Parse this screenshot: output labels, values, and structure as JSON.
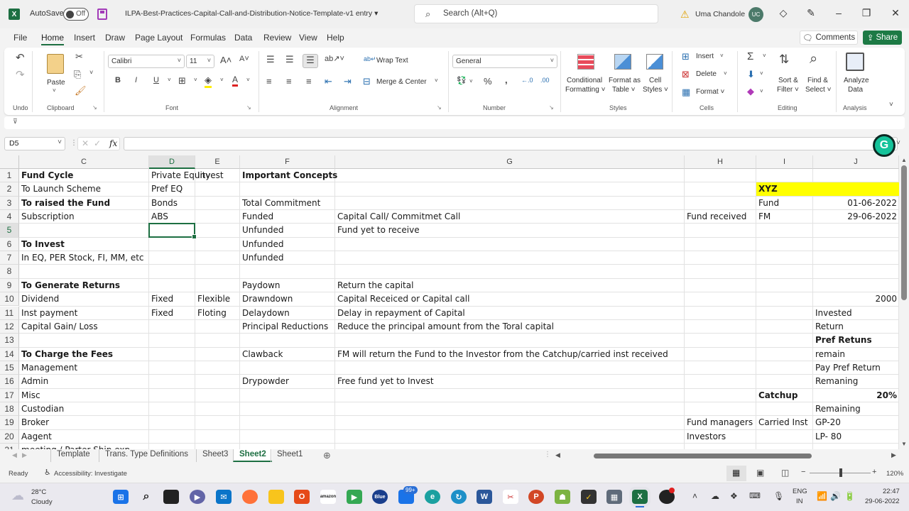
{
  "window": {
    "app_logo": "X",
    "autosave_label": "AutoSave",
    "autosave_state": "Off",
    "document_title": "ILPA-Best-Practices-Capital-Call-and-Distribution-Notice-Template-v1 entry",
    "title_dropdown": "▾",
    "search_placeholder": "Search (Alt+Q)",
    "user_name": "Uma Chandole",
    "user_initials": "UC"
  },
  "menu": {
    "tabs": [
      "File",
      "Home",
      "Insert",
      "Draw",
      "Page Layout",
      "Formulas",
      "Data",
      "Review",
      "View",
      "Help"
    ],
    "active_tab": "Home",
    "comments_label": "Comments",
    "share_label": "Share"
  },
  "ribbon": {
    "groups": {
      "undo": "Undo",
      "clipboard": "Clipboard",
      "font": "Font",
      "alignment": "Alignment",
      "number": "Number",
      "styles": "Styles",
      "cells": "Cells",
      "editing": "Editing",
      "analysis": "Analysis"
    },
    "paste_label": "Paste",
    "font_name": "Calibri",
    "font_size": "11",
    "wrap_text": "Wrap Text",
    "merge_center": "Merge & Center",
    "number_format": "General",
    "conditional_formatting": [
      "Conditional",
      "Formatting ˅"
    ],
    "format_as_table": [
      "Format as",
      "Table ˅"
    ],
    "cell_styles": [
      "Cell",
      "Styles ˅"
    ],
    "insert": "Insert",
    "delete": "Delete",
    "format": "Format",
    "sort_filter": [
      "Sort &",
      "Filter ˅"
    ],
    "find_select": [
      "Find &",
      "Select ˅"
    ],
    "analyze_data": [
      "Analyze",
      "Data"
    ]
  },
  "formula_bar": {
    "name_box": "D5",
    "formula": ""
  },
  "sheet": {
    "columns": [
      "C",
      "D",
      "E",
      "F",
      "G",
      "H",
      "I",
      "J"
    ],
    "selected_column": "D",
    "rows": [
      "1",
      "2",
      "3",
      "4",
      "5",
      "6",
      "7",
      "8",
      "9",
      "10",
      "11",
      "12",
      "13",
      "14",
      "15",
      "16",
      "17",
      "18",
      "19",
      "20",
      "21"
    ],
    "selected_row": "5",
    "selected_cell": "D5",
    "cells": {
      "C1": "Fund Cycle",
      "D1": "Private Equity",
      "E1": "Invest",
      "F1": "Important Concepts",
      "C2": "To Launch Scheme",
      "D2": "Pref EQ",
      "I2": "XYZ",
      "C3": "To raised the Fund",
      "D3": "Bonds",
      "F3": "Total Commitment",
      "I3": "Fund",
      "J3": "01-06-2022",
      "C4": "Subscription",
      "D4": "ABS",
      "F4": "Funded",
      "G4": "Capital Call/ Commitmet Call",
      "H4": "Fund received",
      "I4": "FM",
      "J4": "29-06-2022",
      "F5": "Unfunded",
      "G5": "Fund yet to receive",
      "C6": "To Invest",
      "F6": "Unfunded",
      "C7": "In EQ, PER Stock, FI, MM, etc",
      "F7": "Unfunded",
      "C9": "To Generate Returns",
      "F9": "Paydown",
      "G9": "Return the capital",
      "C10": "Dividend",
      "D10": "Fixed",
      "E10": "Flexible",
      "F10": "Drawndown",
      "G10": "Capital Receiced or Capital call",
      "J10": "2000",
      "C11": "Inst payment",
      "D11": "Fixed",
      "E11": "Floting",
      "F11": "Delaydown",
      "G11": "Delay in repayment of Capital",
      "J11": "Invested",
      "C12": "Capital Gain/ Loss",
      "F12": "Principal Reductions",
      "G12": "Reduce the principal amount from the Toral capital",
      "J12": "Return",
      "J13": "Pref Retuns",
      "C14": "To Charge the Fees",
      "F14": "Clawback",
      "G14": "FM will return the Fund to the Investor from the Catchup/carried inst received",
      "J14": "remain",
      "C15": "Management",
      "J15": "Pay Pref Return",
      "C16": "Admin",
      "F16": "Drypowder",
      "G16": "Free fund yet to Invest",
      "J16": "Remaning",
      "C17": "Misc",
      "I17": "Catchup",
      "J17": "20%",
      "C18": "Custodian",
      "J18": "Remaining",
      "C19": "Broker",
      "H19": "Fund managers",
      "I19": "Carried Inst",
      "J19": "GP-20",
      "C20": "Aagent",
      "H20": "Investors",
      "J20": "LP- 80",
      "C21": "meeting / Parter Ship exp"
    },
    "highlight_color": "#ffff00"
  },
  "sheet_tabs": {
    "tabs": [
      "Template",
      "Trans. Type Definitions",
      "Sheet3",
      "Sheet2",
      "Sheet1"
    ],
    "active": "Sheet2"
  },
  "status_bar": {
    "ready": "Ready",
    "accessibility": "Accessibility: Investigate",
    "zoom": "120%",
    "zoom_minus": "−",
    "zoom_plus": "+"
  },
  "taskbar": {
    "weather_temp": "28°C",
    "weather_desc": "Cloudy",
    "notification_badge": "99+",
    "lang_line1": "ENG",
    "lang_line2": "IN",
    "time": "22:47",
    "date": "29-06-2022"
  },
  "colors": {
    "accent": "#1d6f42",
    "share_button": "#1d7a45"
  }
}
